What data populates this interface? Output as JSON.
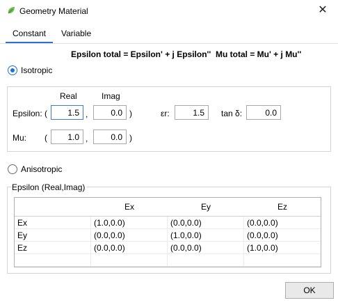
{
  "window": {
    "title": "Geometry Material",
    "close_glyph": "✕",
    "app_icon": "leaf-icon"
  },
  "tabs": [
    {
      "label": "Constant",
      "active": true
    },
    {
      "label": "Variable",
      "active": false
    }
  ],
  "formulas": {
    "epsilon": "Epsilon total = Epsilon' + j Epsilon''",
    "mu": "Mu total = Mu' + j Mu''"
  },
  "isotropic": {
    "label": "Isotropic",
    "selected": true,
    "col_real": "Real",
    "col_imag": "Imag",
    "epsilon_label": "Epsilon:",
    "mu_label": "Mu:",
    "open_paren": "(",
    "comma": ",",
    "close_paren": ")",
    "epsilon_real": "1.5",
    "epsilon_imag": "0.0",
    "mu_real": "1.0",
    "mu_imag": "0.0",
    "er_label": "εr:",
    "er_value": "1.5",
    "tan_label": "tan δ:",
    "tan_value": "0.0"
  },
  "anisotropic": {
    "label": "Anisotropic",
    "selected": false,
    "group_title": "Epsilon (Real,Imag)",
    "columns": [
      "",
      "Ex",
      "Ey",
      "Ez"
    ],
    "rows": [
      {
        "name": "Ex",
        "cells": [
          "(1.0,0.0)",
          "(0.0,0.0)",
          "(0.0,0.0)"
        ]
      },
      {
        "name": "Ey",
        "cells": [
          "(0.0,0.0)",
          "(1.0,0.0)",
          "(0.0,0.0)"
        ]
      },
      {
        "name": "Ez",
        "cells": [
          "(0.0,0.0)",
          "(0.0,0.0)",
          "(1.0,0.0)"
        ]
      }
    ]
  },
  "buttons": {
    "ok": "OK"
  },
  "colors": {
    "accent": "#1e6fd9",
    "tab_underline": "#2f6fd0"
  }
}
